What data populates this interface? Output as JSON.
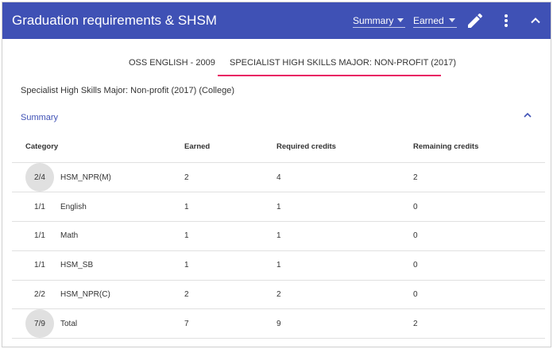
{
  "header": {
    "title": "Graduation requirements & SHSM",
    "view_select": "Summary",
    "filter_select": "Earned",
    "colors": {
      "bar": "#3f51b5",
      "text": "#ffffff"
    },
    "icons": [
      "pencil-icon",
      "more-vert-icon",
      "chevron-up-icon"
    ]
  },
  "tabs": [
    {
      "label": "OSS ENGLISH - 2009",
      "active": false
    },
    {
      "label": "SPECIALIST HIGH SKILLS MAJOR: NON-PROFIT (2017)",
      "active": true
    }
  ],
  "tab_indicator_color": "#e91e63",
  "program_title": "Specialist High Skills Major: Non-profit (2017) (College)",
  "section": {
    "label": "Summary",
    "expanded": true
  },
  "table": {
    "headers": {
      "category": "Category",
      "earned": "Earned",
      "required": "Required credits",
      "remaining": "Remaining credits"
    },
    "rows": [
      {
        "ratio": "2/4",
        "category": "HSM_NPR(M)",
        "earned": "2",
        "required": "4",
        "remaining": "2",
        "highlight": true
      },
      {
        "ratio": "1/1",
        "category": "English",
        "earned": "1",
        "required": "1",
        "remaining": "0",
        "highlight": false
      },
      {
        "ratio": "1/1",
        "category": "Math",
        "earned": "1",
        "required": "1",
        "remaining": "0",
        "highlight": false
      },
      {
        "ratio": "1/1",
        "category": "HSM_SB",
        "earned": "1",
        "required": "1",
        "remaining": "0",
        "highlight": false
      },
      {
        "ratio": "2/2",
        "category": "HSM_NPR(C)",
        "earned": "2",
        "required": "2",
        "remaining": "0",
        "highlight": false
      },
      {
        "ratio": "7/9",
        "category": "Total",
        "earned": "7",
        "required": "9",
        "remaining": "2",
        "highlight": true
      }
    ]
  }
}
